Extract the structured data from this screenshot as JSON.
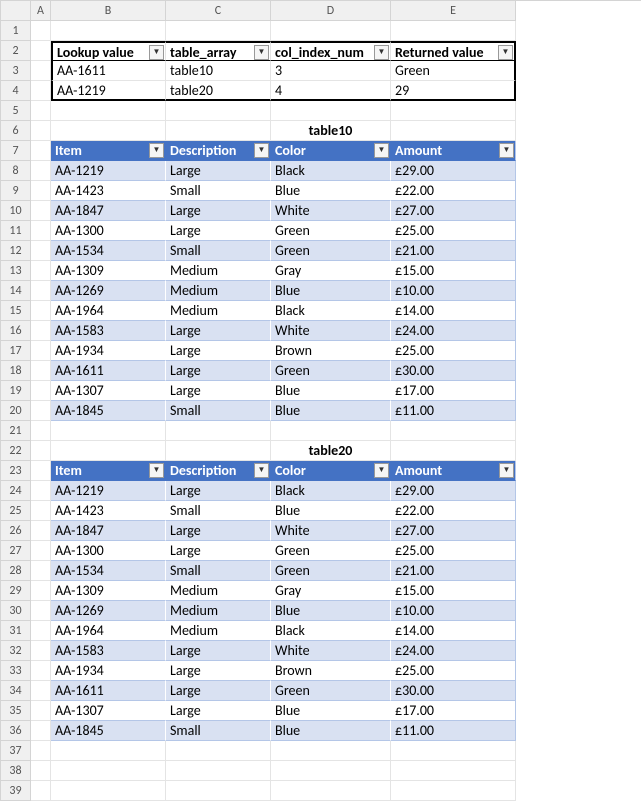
{
  "columns": [
    "",
    "A",
    "B",
    "C",
    "D",
    "E"
  ],
  "lookup": {
    "headers": [
      "Lookup value",
      "table_array",
      "col_index_num",
      "Returned value"
    ],
    "rows": [
      [
        "AA-1611",
        "table10",
        "3",
        "Green"
      ],
      [
        "AA-1219",
        "table20",
        "4",
        "29"
      ]
    ]
  },
  "table10": {
    "title": "table10",
    "headers": [
      "Item",
      "Description",
      "Color",
      "Amount"
    ],
    "rows": [
      [
        "AA-1219",
        "Large",
        "Black",
        "£29.00"
      ],
      [
        "AA-1423",
        "Small",
        "Blue",
        "£22.00"
      ],
      [
        "AA-1847",
        "Large",
        "White",
        "£27.00"
      ],
      [
        "AA-1300",
        "Large",
        "Green",
        "£25.00"
      ],
      [
        "AA-1534",
        "Small",
        "Green",
        "£21.00"
      ],
      [
        "AA-1309",
        "Medium",
        "Gray",
        "£15.00"
      ],
      [
        "AA-1269",
        "Medium",
        "Blue",
        "£10.00"
      ],
      [
        "AA-1964",
        "Medium",
        "Black",
        "£14.00"
      ],
      [
        "AA-1583",
        "Large",
        "White",
        "£24.00"
      ],
      [
        "AA-1934",
        "Large",
        "Brown",
        "£25.00"
      ],
      [
        "AA-1611",
        "Large",
        "Green",
        "£30.00"
      ],
      [
        "AA-1307",
        "Large",
        "Blue",
        "£17.00"
      ],
      [
        "AA-1845",
        "Small",
        "Blue",
        "£11.00"
      ]
    ]
  },
  "table20": {
    "title": "table20",
    "headers": [
      "Item",
      "Description",
      "Color",
      "Amount"
    ],
    "rows": [
      [
        "AA-1219",
        "Large",
        "Black",
        "£29.00"
      ],
      [
        "AA-1423",
        "Small",
        "Blue",
        "£22.00"
      ],
      [
        "AA-1847",
        "Large",
        "White",
        "£27.00"
      ],
      [
        "AA-1300",
        "Large",
        "Green",
        "£25.00"
      ],
      [
        "AA-1534",
        "Small",
        "Green",
        "£21.00"
      ],
      [
        "AA-1309",
        "Medium",
        "Gray",
        "£15.00"
      ],
      [
        "AA-1269",
        "Medium",
        "Blue",
        "£10.00"
      ],
      [
        "AA-1964",
        "Medium",
        "Black",
        "£14.00"
      ],
      [
        "AA-1583",
        "Large",
        "White",
        "£24.00"
      ],
      [
        "AA-1934",
        "Large",
        "Brown",
        "£25.00"
      ],
      [
        "AA-1611",
        "Large",
        "Green",
        "£30.00"
      ],
      [
        "AA-1307",
        "Large",
        "Blue",
        "£17.00"
      ],
      [
        "AA-1845",
        "Small",
        "Blue",
        "£11.00"
      ]
    ]
  }
}
